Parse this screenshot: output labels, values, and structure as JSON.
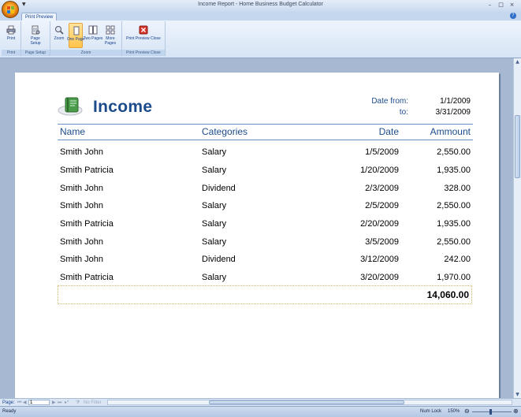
{
  "window": {
    "title": "Income Report - Home Business Budget Calculator",
    "minimize": "–",
    "maximize": "□",
    "close": "×"
  },
  "ribbon": {
    "tab": "Print Preview",
    "help": "?",
    "groups": {
      "print": {
        "label": "Print",
        "buttons": {
          "print": "Print"
        }
      },
      "page_setup": {
        "label": "Page Setup",
        "buttons": {
          "page_setup": "Page Setup"
        }
      },
      "zoom": {
        "label": "Zoom",
        "buttons": {
          "zoom": "Zoom",
          "one_page": "One Page",
          "two_pages": "Two Pages",
          "more_pages": "More Pages"
        }
      },
      "close": {
        "label": "Print Preview Close",
        "buttons": {
          "close_preview": "Print Preview Close"
        }
      }
    }
  },
  "report": {
    "title": "Income",
    "date_from_label": "Date from:",
    "date_from": "1/1/2009",
    "date_to_label": "to:",
    "date_to": "3/31/2009",
    "columns": [
      "Name",
      "Categories",
      "Date",
      "Ammount"
    ],
    "rows": [
      [
        "Smith John",
        "Salary",
        "1/5/2009",
        "2,550.00"
      ],
      [
        "Smith Patricia",
        "Salary",
        "1/20/2009",
        "1,935.00"
      ],
      [
        "Smith John",
        "Dividend",
        "2/3/2009",
        "328.00"
      ],
      [
        "Smith John",
        "Salary",
        "2/5/2009",
        "2,550.00"
      ],
      [
        "Smith Patricia",
        "Salary",
        "2/20/2009",
        "1,935.00"
      ],
      [
        "Smith John",
        "Salary",
        "3/5/2009",
        "2,550.00"
      ],
      [
        "Smith John",
        "Dividend",
        "3/12/2009",
        "242.00"
      ],
      [
        "Smith Patricia",
        "Salary",
        "3/20/2009",
        "1,970.00"
      ]
    ],
    "total": "14,060.00"
  },
  "navigation": {
    "page_label": "Page:",
    "page_value": "1",
    "filter": "No Filter"
  },
  "status": {
    "ready": "Ready",
    "num_lock": "Num Lock",
    "zoom": "150%"
  },
  "colors": {
    "accent": "#1b4b8a",
    "ribbon": "#d6e4f5",
    "workspace": "#a7b9d2"
  }
}
